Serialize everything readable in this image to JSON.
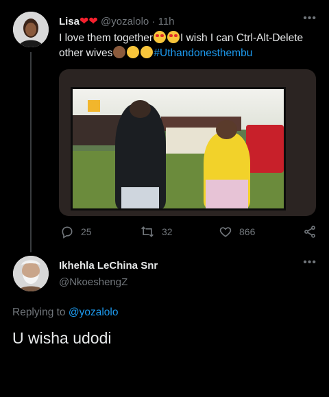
{
  "original_tweet": {
    "display_name": "Lisa",
    "name_emojis": [
      "heart",
      "heart"
    ],
    "handle": "@yozalolo",
    "separator": "·",
    "time": "11h",
    "text_part1": "I love them together",
    "text_part2": "I wish I can Ctrl-Alt-Delete other wives",
    "hashtag": "#Uthandonesthembu",
    "stats": {
      "replies": "25",
      "retweets": "32",
      "likes": "866"
    }
  },
  "reply_tweet": {
    "display_name": "Ikhehla LeChina Snr",
    "handle": "@NkoeshengZ",
    "replying_label": "Replying to",
    "replying_handle": "@yozalolo",
    "text": "U wisha udodi"
  },
  "icons": {
    "more": "more-horizontal-icon",
    "reply": "reply-icon",
    "retweet": "retweet-icon",
    "like": "heart-icon",
    "share": "share-icon"
  },
  "colors": {
    "background": "#000000",
    "text": "#e7e9ea",
    "muted": "#71767b",
    "link": "#1d9bf0",
    "heart": "#f4212e"
  }
}
